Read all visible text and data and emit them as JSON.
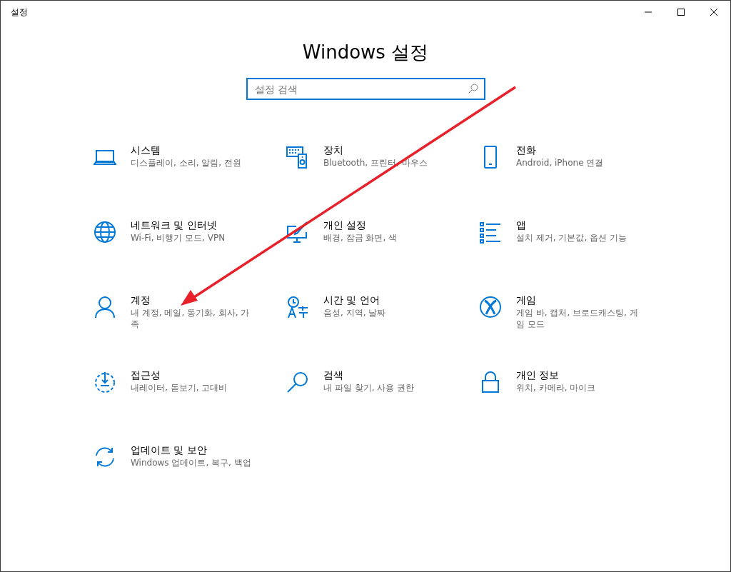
{
  "window": {
    "title": "설정"
  },
  "header": {
    "title": "Windows 설정"
  },
  "search": {
    "placeholder": "설정 검색"
  },
  "items": [
    {
      "title": "시스템",
      "subtitle": "디스플레이, 소리, 알림, 전원"
    },
    {
      "title": "장치",
      "subtitle": "Bluetooth, 프린터, 마우스"
    },
    {
      "title": "전화",
      "subtitle": "Android, iPhone 연결"
    },
    {
      "title": "네트워크 및 인터넷",
      "subtitle": "Wi-Fi, 비행기 모드, VPN"
    },
    {
      "title": "개인 설정",
      "subtitle": "배경, 잠금 화면, 색"
    },
    {
      "title": "앱",
      "subtitle": "설치 제거, 기본값, 옵션 기능"
    },
    {
      "title": "계정",
      "subtitle": "내 계정, 메일, 동기화, 회사, 가족"
    },
    {
      "title": "시간 및 언어",
      "subtitle": "음성, 지역, 날짜"
    },
    {
      "title": "게임",
      "subtitle": "게임 바, 캡처, 브로드캐스팅, 게임 모드"
    },
    {
      "title": "접근성",
      "subtitle": "내레이터, 돋보기, 고대비"
    },
    {
      "title": "검색",
      "subtitle": "내 파일 찾기, 사용 권한"
    },
    {
      "title": "개인 정보",
      "subtitle": "위치, 카메라, 마이크"
    },
    {
      "title": "업데이트 및 보안",
      "subtitle": "Windows 업데이트, 복구, 백업"
    }
  ]
}
